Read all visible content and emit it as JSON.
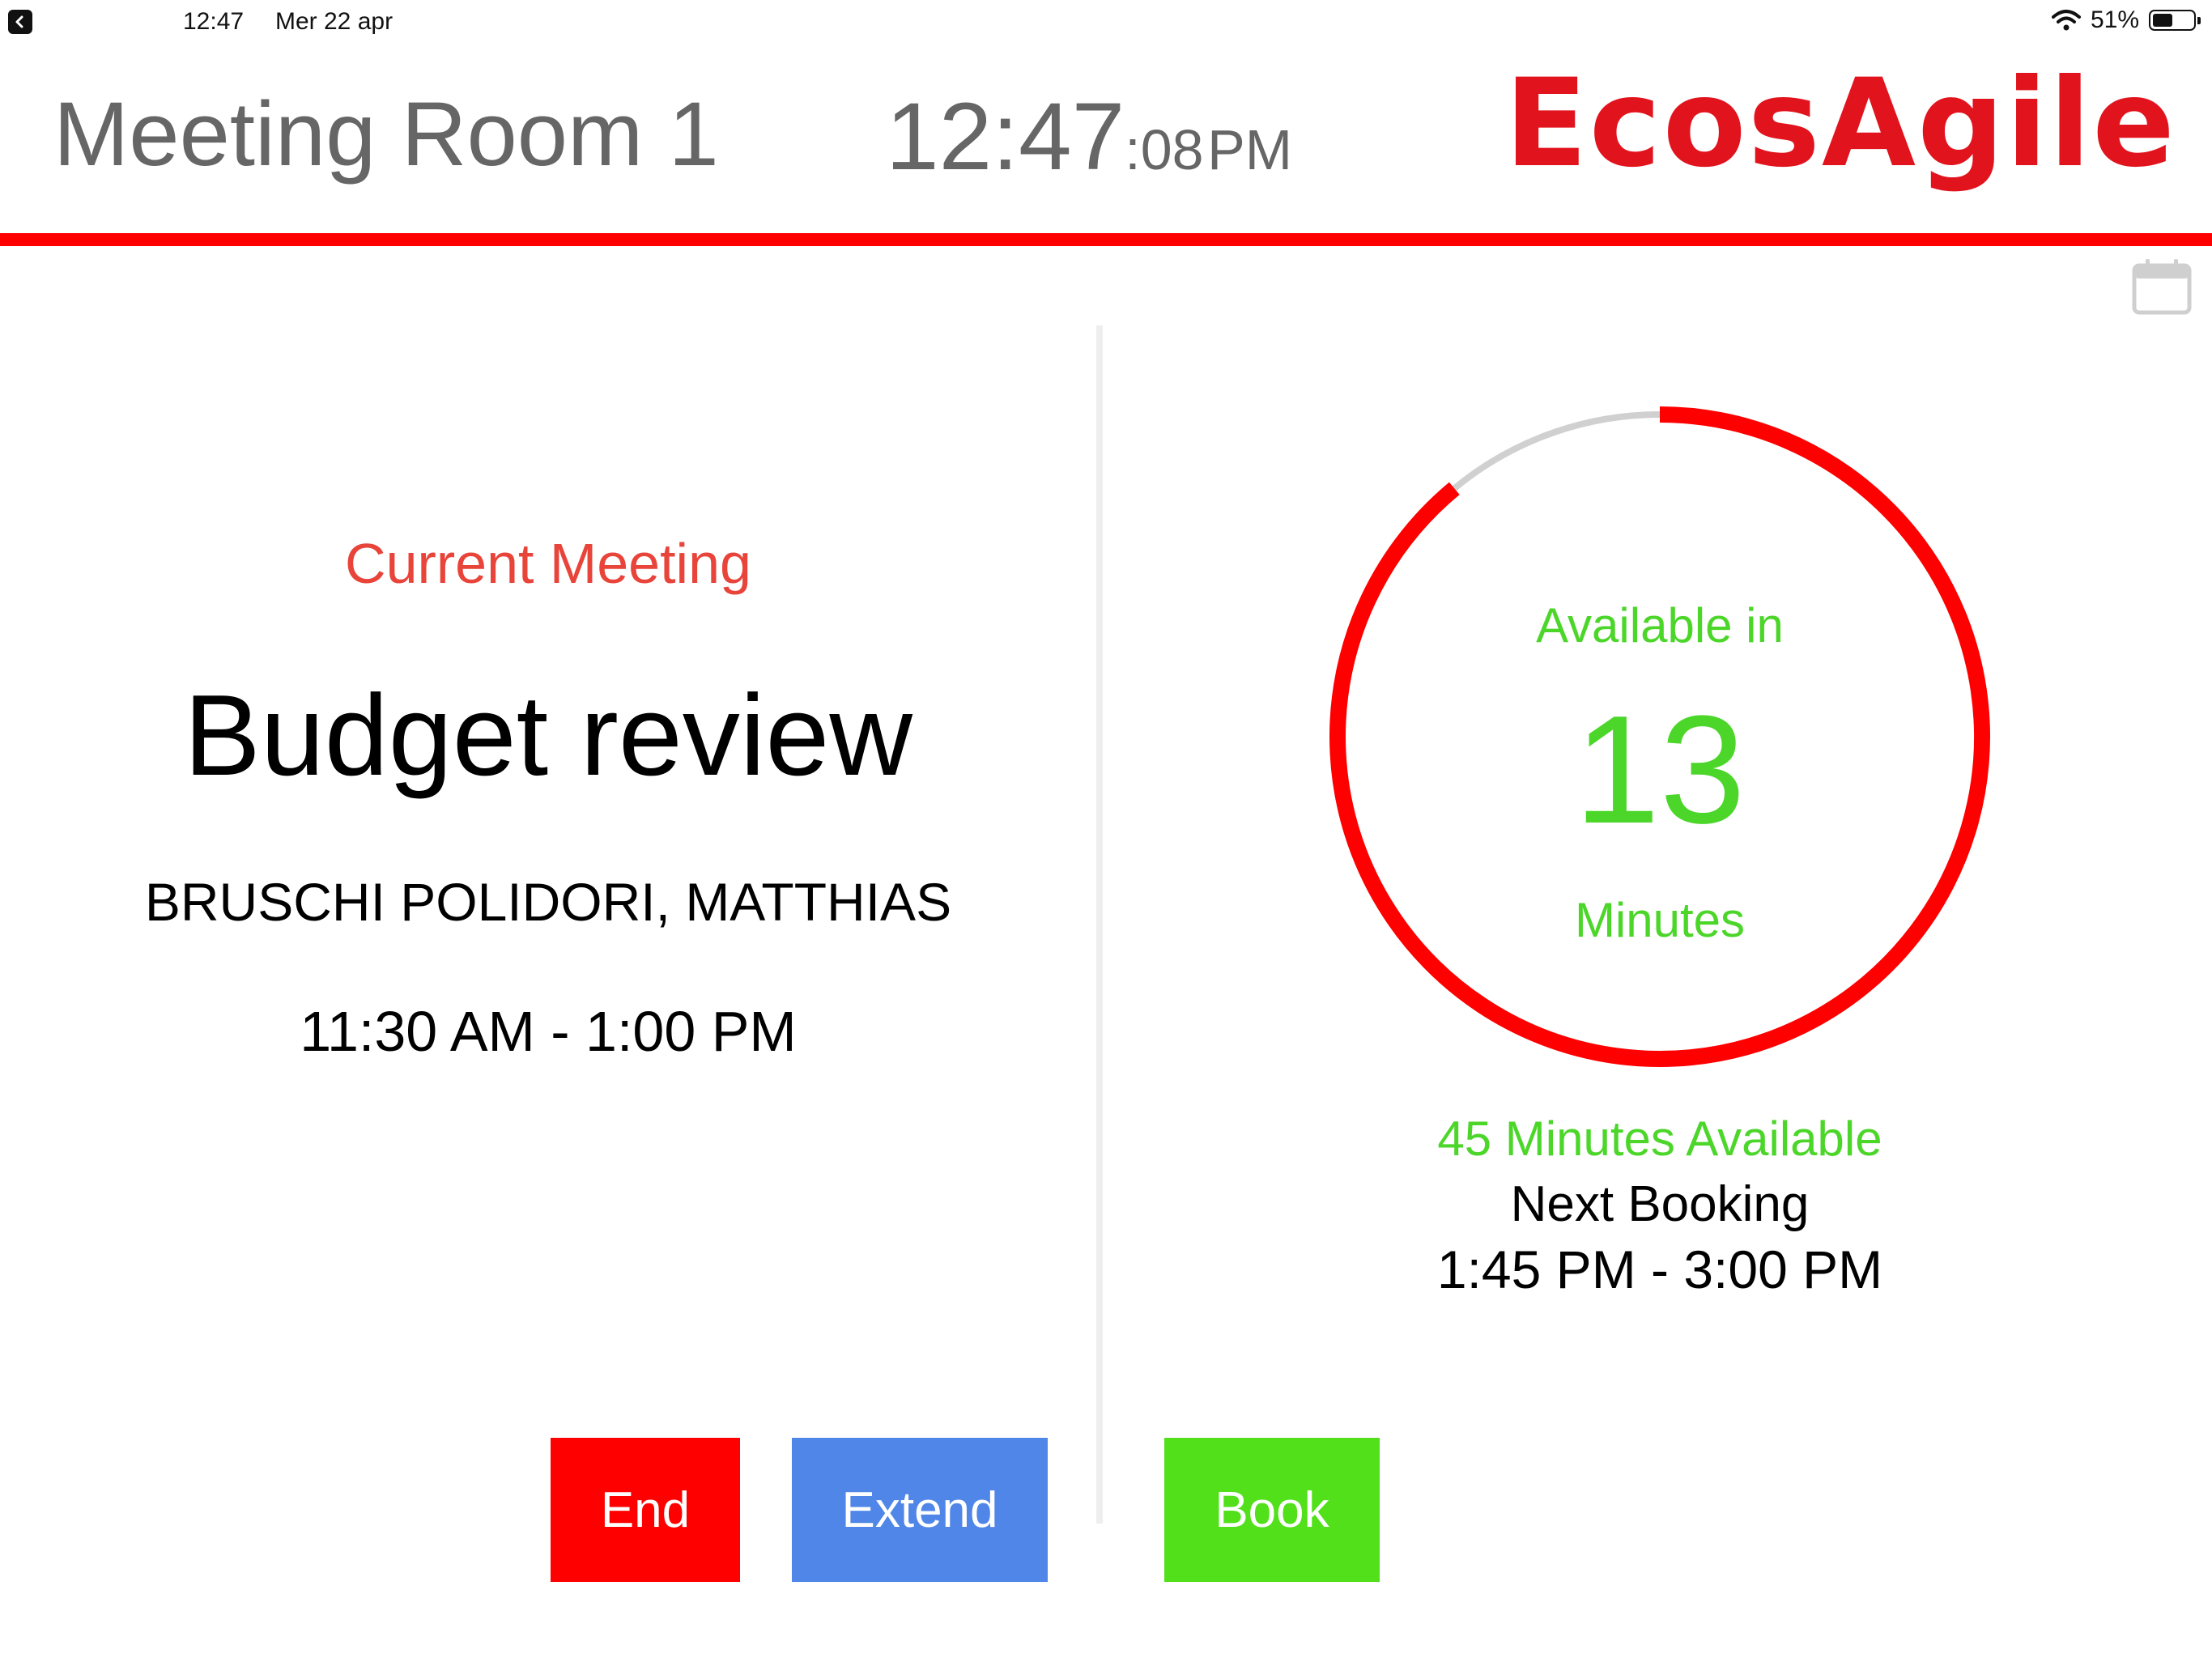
{
  "status_bar": {
    "time": "12:47",
    "date": "Mer 22 apr",
    "battery_percent": "51%",
    "battery_level": 0.51
  },
  "header": {
    "room_name": "Meeting Room 1",
    "clock_main": "12:47",
    "clock_seconds": ":08",
    "clock_ampm": "PM",
    "logo_text": "EcosAgile"
  },
  "current_meeting": {
    "label": "Current Meeting",
    "title": "Budget review",
    "organizer": "BRUSCHI POLIDORI, MATTHIAS",
    "time": "11:30 AM - 1:00 PM"
  },
  "availability": {
    "prefix": "Available in",
    "minutes": "13",
    "unit": "Minutes",
    "progress_fraction": 0.89,
    "minutes_available": "45 Minutes Available",
    "next_booking_label": "Next Booking",
    "next_booking_time": "1:45 PM - 3:00 PM"
  },
  "buttons": {
    "end": "End",
    "extend": "Extend",
    "book": "Book"
  },
  "colors": {
    "accent_red": "#ff0000",
    "logo_red": "#e1141e",
    "available_green": "#4cd62a",
    "extend_blue": "#4f86e8",
    "book_green": "#52e01a",
    "header_gray": "#666666"
  },
  "icons": {
    "back": "chevron-left-icon",
    "wifi": "wifi-icon",
    "battery": "battery-icon",
    "calendar": "calendar-icon"
  }
}
